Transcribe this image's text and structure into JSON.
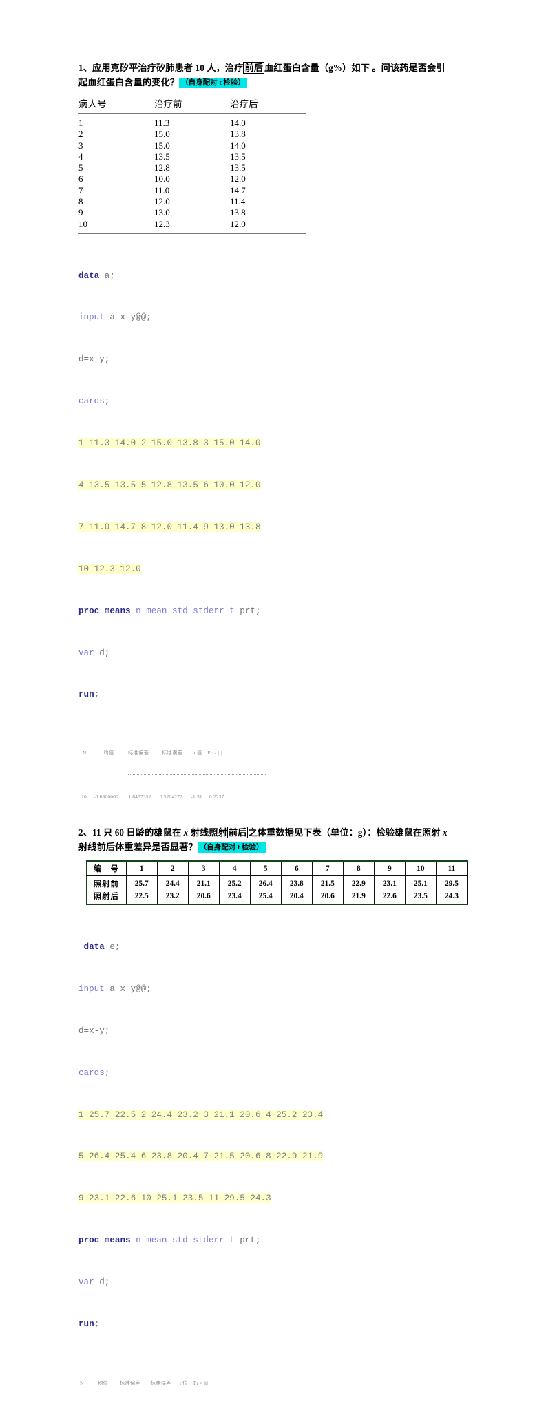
{
  "doc": {
    "q1": {
      "line1_a": "1、应用克矽平治疗矽肺患者 10 人，治疗",
      "line1_boxed": "前后",
      "line1_b": "血红蛋白含量（g%）如下 。问该药是否会引",
      "line2_a": "起血红蛋白含量的变化？",
      "tag": "（自身配对 t 检验）"
    },
    "table1": {
      "headers": [
        "病人号",
        "治疗前",
        "治疗后"
      ],
      "rows": [
        [
          "1",
          "11.3",
          "14.0"
        ],
        [
          "2",
          "15.0",
          "13.8"
        ],
        [
          "3",
          "15.0",
          "14.0"
        ],
        [
          "4",
          "13.5",
          "13.5"
        ],
        [
          "5",
          "12.8",
          "13.5"
        ],
        [
          "6",
          "10.0",
          "12.0"
        ],
        [
          "7",
          "11.0",
          "14.7"
        ],
        [
          "8",
          "12.0",
          "11.4"
        ],
        [
          "9",
          "13.0",
          "13.8"
        ],
        [
          "10",
          "12.3",
          "12.0"
        ]
      ]
    },
    "code1": {
      "l1_kw": "data",
      "l1_rest": " a;",
      "l2_kw": "input",
      "l2_rest": " a x y@@;",
      "l3": "d=x-y;",
      "l4_kw": "cards",
      "l4_rest": ";",
      "data_lines": [
        "1 11.3 14.0 2 15.0 13.8 3 15.0 14.0",
        "4 13.5 13.5 5 12.8 13.5 6 10.0 12.0",
        "7 11.0 14.7 8 12.0 11.4 9 13.0 13.8",
        "10 12.3 12.0"
      ],
      "l9_kw": "proc means",
      "l9_opts": " n mean std stderr t",
      "l9_rest": " prt;",
      "l10_kw": "var",
      "l10_rest": " d;",
      "l11_kw": "run",
      "l11_rest": ";"
    },
    "output1": {
      "header": "   N            均值          标准偏差         标准误差        t 值    Pr > |t|",
      "values": "  10     -0.6800000       1.6457352      0.5204272      -1.31     0.2237"
    },
    "q2": {
      "line1_a": "2、11 只 60 日龄的雄鼠在 ",
      "line1_x1": "x",
      "line1_b": " 射线照射",
      "line1_boxed": "前后",
      "line1_c": "之体重数据见下表（单位：g）：检验雄鼠在照射 ",
      "line1_x2": "x",
      "line2_a": "射线前后体重差异是否显著？",
      "tag": "（自身配对 t 检验）"
    },
    "table2": {
      "row_labels": [
        "编　号",
        "照射前",
        "照射后"
      ],
      "ids": [
        "1",
        "2",
        "3",
        "4",
        "5",
        "6",
        "7",
        "8",
        "9",
        "10",
        "11"
      ],
      "before": [
        "25.7",
        "24.4",
        "21.1",
        "25.2",
        "26.4",
        "23.8",
        "21.5",
        "22.9",
        "23.1",
        "25.1",
        "29.5"
      ],
      "after": [
        "22.5",
        "23.2",
        "20.6",
        "23.4",
        "25.4",
        "20.4",
        "20.6",
        "21.9",
        "22.6",
        "23.5",
        "24.3"
      ]
    },
    "code2": {
      "l1_kw": " data",
      "l1_rest": " e;",
      "l2_kw": "input",
      "l2_rest": " a x y@@;",
      "l3": "d=x-y;",
      "l4_kw": "cards",
      "l4_rest": ";",
      "data_lines": [
        "1 25.7 22.5 2 24.4 23.2 3 21.1 20.6 4 25.2 23.4",
        "5 26.4 25.4 6 23.8 20.4 7 21.5 20.6 8 22.9 21.9",
        "9 23.1 22.6 10 25.1 23.5 11 29.5 24.3"
      ],
      "l8_kw": "proc means",
      "l8_opts": " n mean std stderr t",
      "l8_rest": " prt;",
      "l9_kw": "var",
      "l9_rest": " d;",
      "l10_kw": "run",
      "l10_rest": ";"
    },
    "output2": {
      "header": " N          均值        标准偏差       标准误差      t 值    Pr > |t|"
    }
  }
}
